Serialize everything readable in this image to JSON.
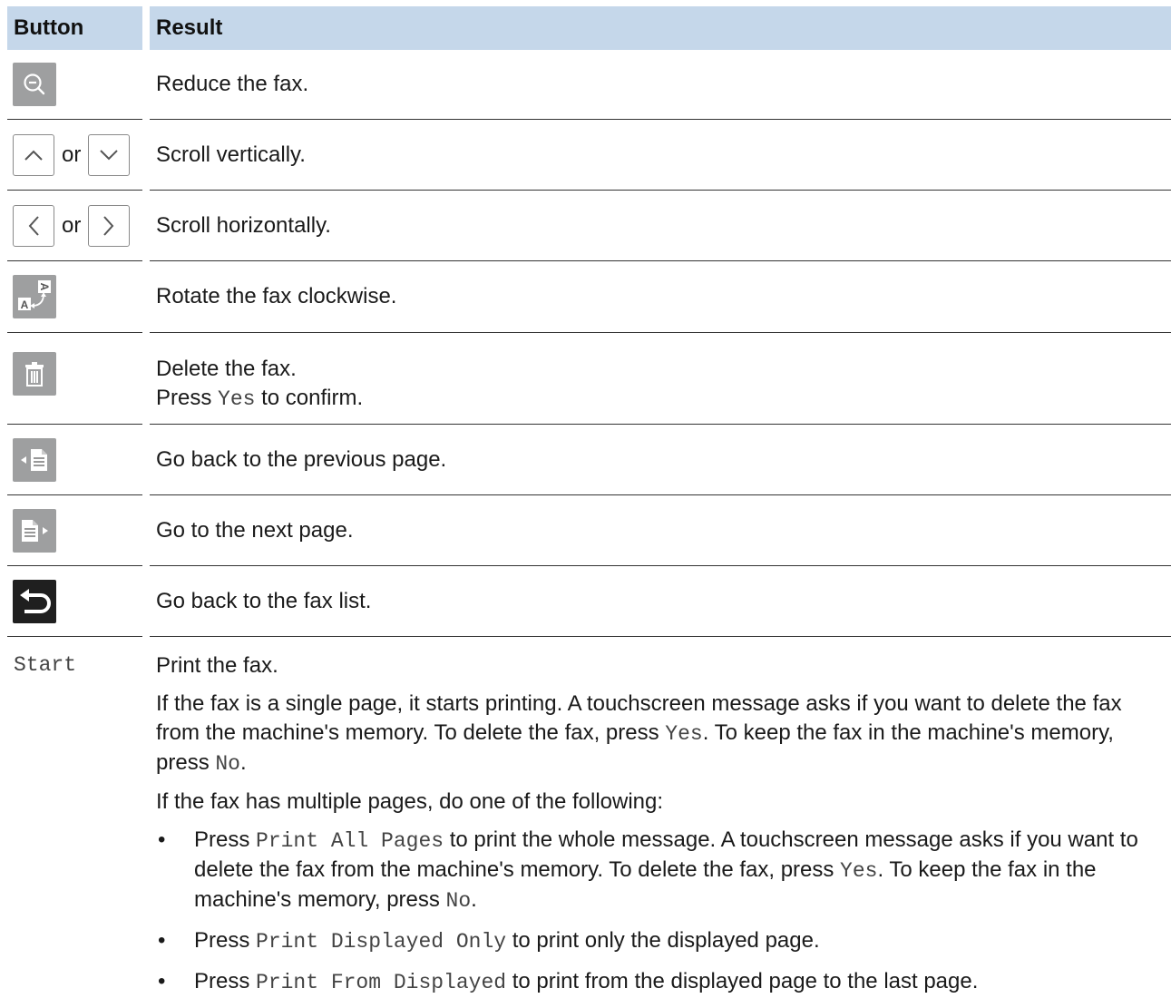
{
  "header": {
    "button": "Button",
    "result": "Result"
  },
  "rows": [
    {
      "icon": "zoom-out-icon",
      "result": "Reduce the fax."
    },
    {
      "icon_a": "chevron-up-icon",
      "or": "or",
      "icon_b": "chevron-down-icon",
      "result": "Scroll vertically."
    },
    {
      "icon_a": "chevron-left-icon",
      "or": "or",
      "icon_b": "chevron-right-icon",
      "result": "Scroll horizontally."
    },
    {
      "icon": "rotate-icon",
      "result": "Rotate the fax clockwise."
    },
    {
      "icon": "trash-icon",
      "result_line1": "Delete the fax.",
      "result_line2_pre": "Press ",
      "result_line2_code": "Yes",
      "result_line2_post": " to confirm."
    },
    {
      "icon": "previous-page-icon",
      "result": "Go back to the previous page."
    },
    {
      "icon": "next-page-icon",
      "result": "Go to the next page."
    },
    {
      "icon": "back-icon",
      "result": "Go back to the fax list."
    }
  ],
  "start_row": {
    "button": "Start",
    "line1": "Print the fax.",
    "para2": {
      "t1": "If the fax is a single page, it starts printing. A touchscreen message asks if you want to delete the fax from the machine's memory. To delete the fax, press ",
      "c1": "Yes",
      "t2": ". To keep the fax in the machine's memory, press ",
      "c2": "No",
      "t3": "."
    },
    "para3": "If the fax has multiple pages, do one of the following:",
    "bullets": [
      {
        "pre": "Press ",
        "code": "Print All Pages",
        "post": " to print the whole message. A touchscreen message asks if you want to delete the fax from the machine's memory. To delete the fax, press ",
        "c2": "Yes",
        "t2": ". To keep the fax in the machine's memory, press ",
        "c3": "No",
        "t3": "."
      },
      {
        "pre": "Press ",
        "code": "Print Displayed Only",
        "post": " to print only the displayed page."
      },
      {
        "pre": "Press ",
        "code": "Print From Displayed",
        "post": " to print from the displayed page to the last page."
      }
    ],
    "bullet_char": "•"
  }
}
